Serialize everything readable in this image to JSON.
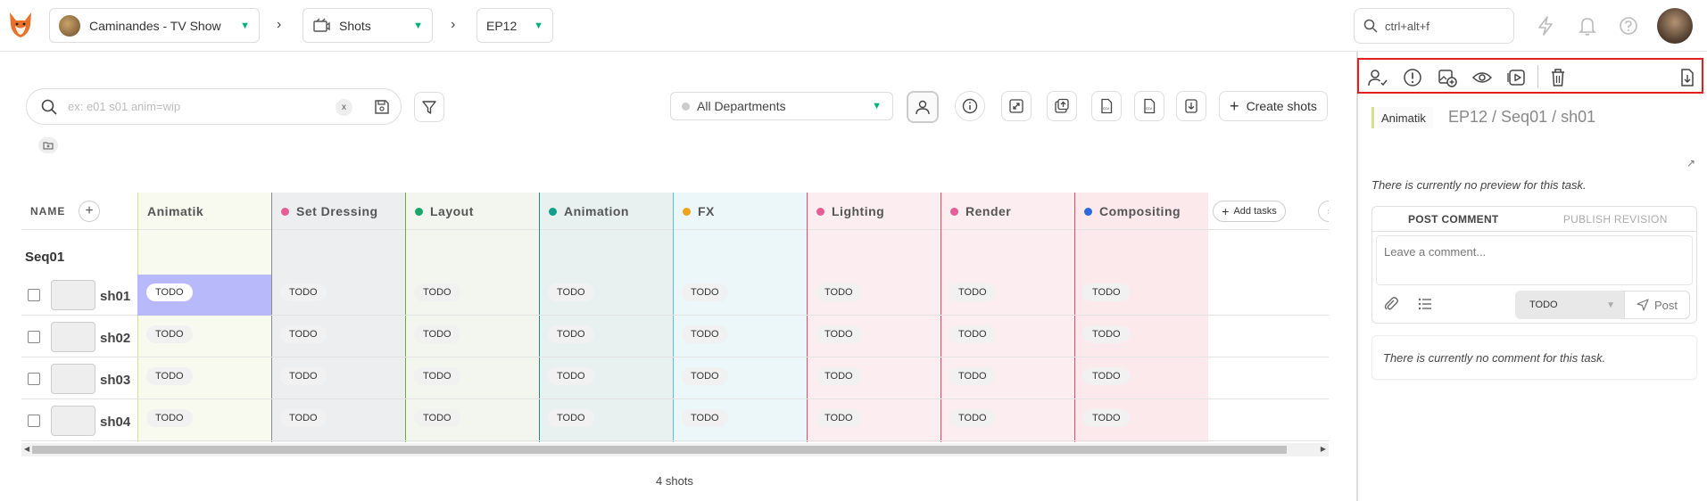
{
  "header": {
    "production": "Caminandes - TV Show",
    "section": "Shots",
    "episode": "EP12",
    "global_search_placeholder": "ctrl+alt+f"
  },
  "toolbar": {
    "search_placeholder": "ex: e01 s01 anim=wip",
    "clear_label": "x",
    "department_filter": "All Departments",
    "create_shots_label": "Create shots"
  },
  "grid": {
    "name_header": "NAME",
    "add_tasks_label": "Add tasks",
    "sequence": "Seq01",
    "columns": [
      {
        "label": "Animatik",
        "dot": "",
        "border": "#d5e28b",
        "tint": "#f8f9ef"
      },
      {
        "label": "Set Dressing",
        "dot": "#e85d95",
        "border": "#8a8a8a",
        "tint": "#edeef0"
      },
      {
        "label": "Layout",
        "dot": "#19a66a",
        "border": "#6fa84a",
        "tint": "#f2f6ee"
      },
      {
        "label": "Animation",
        "dot": "#0f9f8a",
        "border": "#1e8f7d",
        "tint": "#e8f1ef"
      },
      {
        "label": "FX",
        "dot": "#f0a21a",
        "border": "#5bc0d3",
        "tint": "#ebf7f9"
      },
      {
        "label": "Lighting",
        "dot": "#e85d95",
        "border": "#e24a6a",
        "tint": "#fbedf0"
      },
      {
        "label": "Render",
        "dot": "#e85d95",
        "border": "#e24a6a",
        "tint": "#fbedf0"
      },
      {
        "label": "Compositing",
        "dot": "#2a6ad9",
        "border": "#e24a6a",
        "tint": "#fbe9ec"
      }
    ],
    "rows": [
      {
        "name": "sh01",
        "statuses": [
          "TODO",
          "TODO",
          "TODO",
          "TODO",
          "TODO",
          "TODO",
          "TODO",
          "TODO"
        ]
      },
      {
        "name": "sh02",
        "statuses": [
          "TODO",
          "TODO",
          "TODO",
          "TODO",
          "TODO",
          "TODO",
          "TODO",
          "TODO"
        ]
      },
      {
        "name": "sh03",
        "statuses": [
          "TODO",
          "TODO",
          "TODO",
          "TODO",
          "TODO",
          "TODO",
          "TODO",
          "TODO"
        ]
      },
      {
        "name": "sh04",
        "statuses": [
          "TODO",
          "TODO",
          "TODO",
          "TODO",
          "TODO",
          "TODO",
          "TODO",
          "TODO"
        ]
      }
    ],
    "shot_count": "4 shots"
  },
  "panel": {
    "task_type": "Animatik",
    "entity_path": "EP12 / Seq01 / sh01",
    "no_preview": "There is currently no preview for this task.",
    "tab_post_comment": "POST COMMENT",
    "tab_publish_revision": "PUBLISH REVISION",
    "comment_placeholder": "Leave a comment...",
    "status_value": "TODO",
    "post_label": "Post",
    "no_comment": "There is currently no comment for this task."
  },
  "colors": {
    "accent": "#00b27a",
    "selection": "#b7b9fa",
    "highlight_border": "#e02020"
  }
}
